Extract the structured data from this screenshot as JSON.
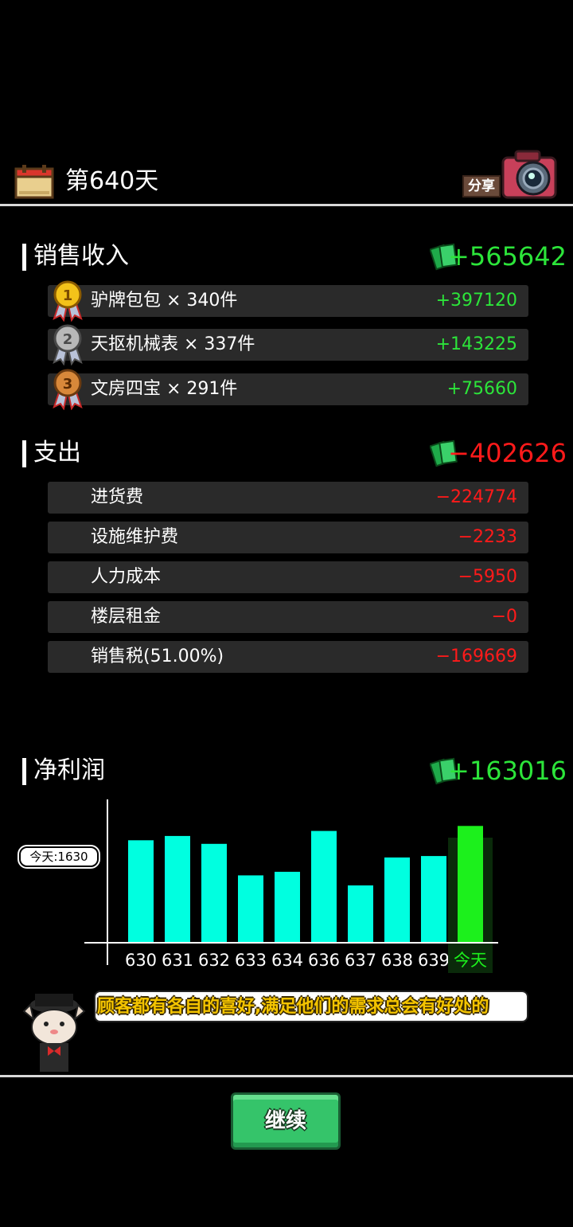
{
  "header": {
    "day_title": "第640天",
    "share_label": "分享"
  },
  "income": {
    "title": "销售收入",
    "total": "+565642",
    "items": [
      {
        "rank": "1",
        "label": "驴牌包包 × 340件",
        "value": "+397120"
      },
      {
        "rank": "2",
        "label": "天抠机械表 × 337件",
        "value": "+143225"
      },
      {
        "rank": "3",
        "label": "文房四宝 × 291件",
        "value": "+75660"
      }
    ]
  },
  "expense": {
    "title": "支出",
    "total": "−402626",
    "items": [
      {
        "label": "进货费",
        "value": "−224774"
      },
      {
        "label": "设施维护费",
        "value": "−2233"
      },
      {
        "label": "人力成本",
        "value": "−5950"
      },
      {
        "label": "楼层租金",
        "value": "−0"
      },
      {
        "label": "销售税(51.00%)",
        "value": "−169669"
      }
    ]
  },
  "profit": {
    "title": "净利润",
    "total": "+163016"
  },
  "chart_data": {
    "type": "bar",
    "categories": [
      "630",
      "631",
      "632",
      "633",
      "634",
      "636",
      "637",
      "638",
      "639",
      "今天"
    ],
    "values": [
      1430,
      1490,
      1380,
      940,
      990,
      1560,
      800,
      1190,
      1210,
      1630
    ],
    "today_label": "今天:1630",
    "highlight_index": 9,
    "colors": {
      "bar": "#00ffe0",
      "today": "#1cf01c",
      "today_bg": "#0a2a0a"
    },
    "ylim": [
      0,
      2000
    ]
  },
  "tip": {
    "text": "顾客都有各自的喜好,满足他们的需求总会有好处的"
  },
  "continue_label": "继续",
  "colors": {
    "positive": "#2ce53a",
    "negative": "#ff1a1a",
    "row_bg": "#2a2a2a"
  }
}
